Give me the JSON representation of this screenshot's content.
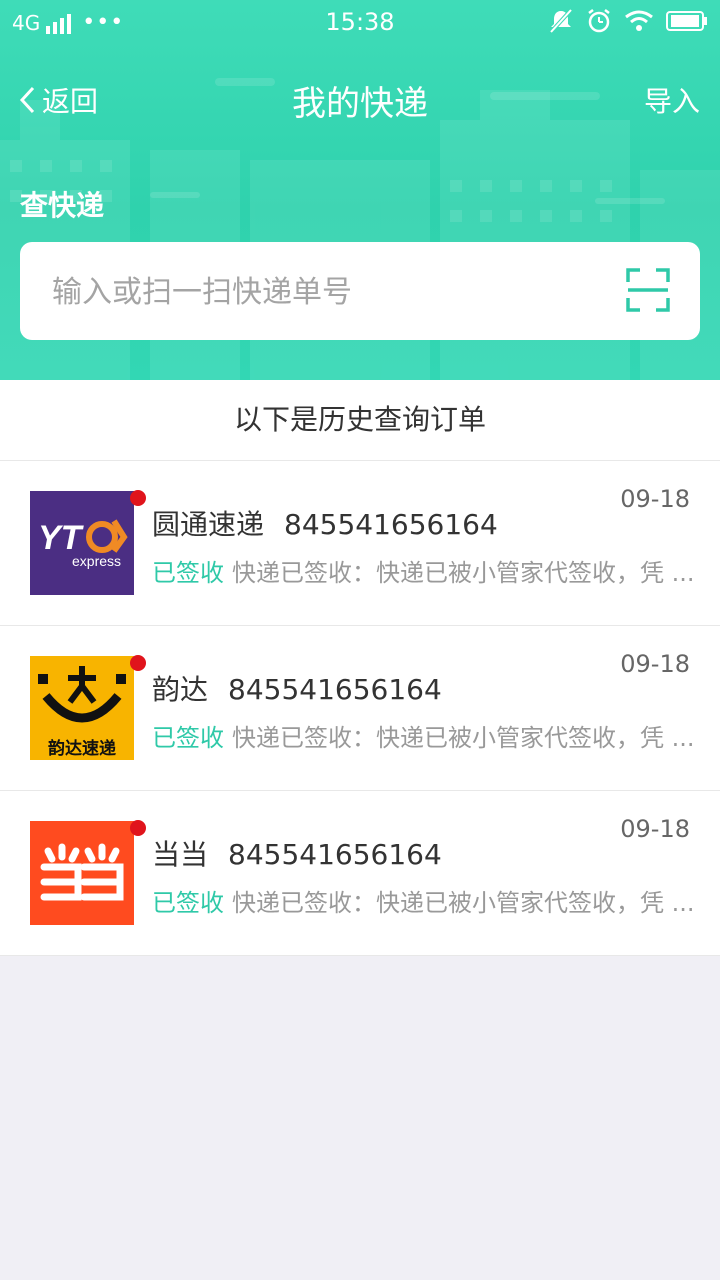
{
  "statusbar": {
    "network": "4G",
    "dots": "•••",
    "time": "15:38"
  },
  "nav": {
    "back_label": "返回",
    "title": "我的快递",
    "import_label": "导入"
  },
  "query": {
    "label": "查快递",
    "placeholder": "输入或扫一扫快递单号"
  },
  "history_title": "以下是历史查询订单",
  "orders": [
    {
      "company": "圆通速递",
      "number": "845541656164",
      "date": "09-18",
      "status": "已签收",
      "detail": "快递已签收：快递已被小管家代签收，凭 ...",
      "logo": "yto-express-logo",
      "logo_color": "#4b2e83",
      "logo_text": "express"
    },
    {
      "company": "韵达",
      "number": "845541656164",
      "date": "09-18",
      "status": "已签收",
      "detail": "快递已签收：快递已被小管家代签收，凭 ...",
      "logo": "yunda-logo",
      "logo_color": "#f8b400",
      "logo_text": "韵达速递"
    },
    {
      "company": "当当",
      "number": "845541656164",
      "date": "09-18",
      "status": "已签收",
      "detail": "快递已签收：快递已被小管家代签收，凭 ...",
      "logo": "dangdang-logo",
      "logo_color": "#ff4b1f"
    }
  ],
  "colors": {
    "accent": "#2fd2ad",
    "signed": "#2fc9a8",
    "unread_dot": "#e0141c"
  }
}
